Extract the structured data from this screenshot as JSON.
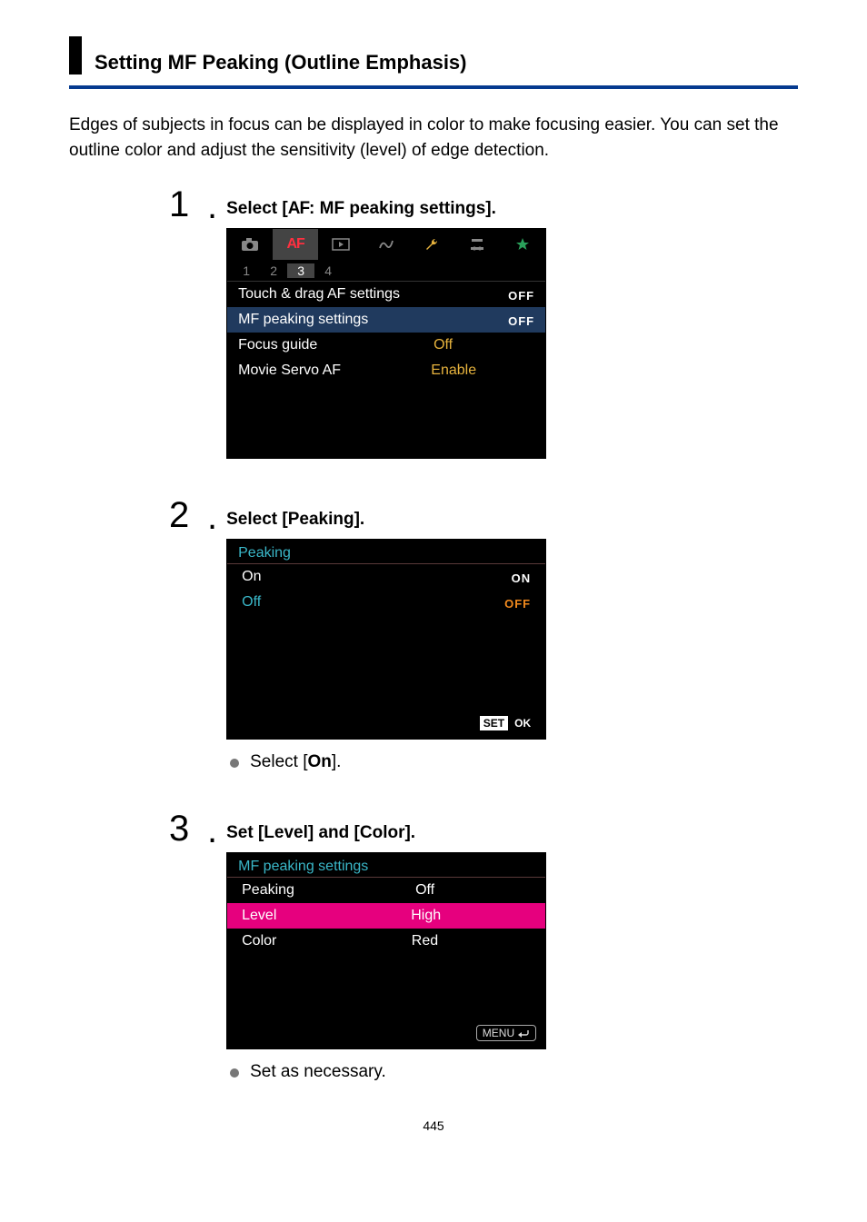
{
  "heading": "Setting MF Peaking (Outline Emphasis)",
  "intro": "Edges of subjects in focus can be displayed in color to make focusing easier. You can set the outline color and adjust the sensitivity (level) of edge detection.",
  "steps": {
    "s1": {
      "number": "1",
      "title_pre": "Select [",
      "title_glyph": "AF",
      "title_post": ": MF peaking settings].",
      "tabs": {
        "af": "AF"
      },
      "subtabs": [
        "1",
        "2",
        "3",
        "4"
      ],
      "rows": {
        "touch": {
          "label": "Touch & drag AF settings",
          "value": "OFF"
        },
        "peak": {
          "label": "MF peaking settings",
          "value": "OFF"
        },
        "guide": {
          "label": "Focus guide",
          "value": "Off"
        },
        "servo": {
          "label": "Movie Servo AF",
          "value": "Enable"
        }
      }
    },
    "s2": {
      "number": "2",
      "title": "Select [Peaking].",
      "screen_title": "Peaking",
      "on": {
        "label": "On",
        "tag": "ON"
      },
      "off": {
        "label": "Off",
        "tag": "OFF"
      },
      "set": "SET",
      "ok": "OK",
      "bullet_pre": "Select [",
      "bullet_bold": "On",
      "bullet_post": "]."
    },
    "s3": {
      "number": "3",
      "title": "Set [Level] and [Color].",
      "screen_title": "MF peaking settings",
      "rows": {
        "peaking": {
          "label": "Peaking",
          "value": "Off"
        },
        "level": {
          "label": "Level",
          "value": "High"
        },
        "color": {
          "label": "Color",
          "value": "Red"
        }
      },
      "menu": "MENU",
      "bullet": "Set as necessary."
    }
  },
  "page_number": "445"
}
